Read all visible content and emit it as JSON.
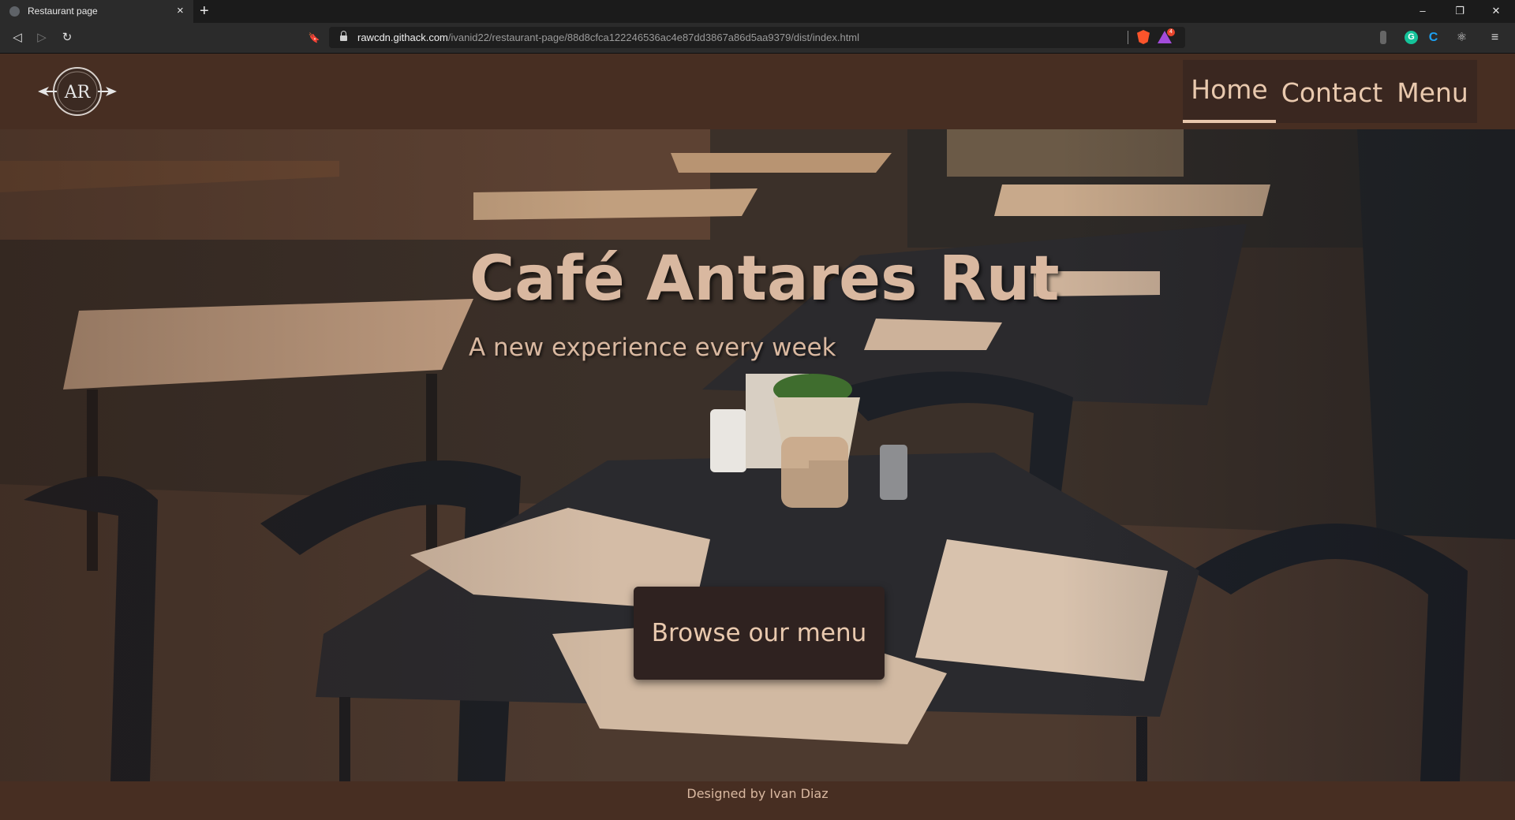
{
  "browser": {
    "tab": {
      "title": "Restaurant page",
      "close_glyph": "×",
      "favicon": "globe-icon"
    },
    "new_tab_glyph": "+",
    "window_controls": {
      "minimize": "–",
      "restore": "❐",
      "close": "✕"
    },
    "nav": {
      "back": "◁",
      "forward": "▷",
      "reload": "↻",
      "bookmark": "🔖"
    },
    "url": {
      "host": "rawcdn.githack.com",
      "path": "/ivanid22/restaurant-page/88d8cfca122246536ac4e87dd3867a86d5aa9379/dist/index.html"
    },
    "extensions": {
      "rewards_badge": "4",
      "grammarly": "G",
      "cc": "C",
      "react": "⚛",
      "menu": "≡"
    }
  },
  "site": {
    "logo_initials": "AR",
    "nav": [
      {
        "label": "Home",
        "active": true
      },
      {
        "label": "Contact",
        "active": false
      },
      {
        "label": "Menu",
        "active": false
      }
    ],
    "hero": {
      "title": "Café Antares Rut",
      "subtitle": "A new experience every week",
      "cta": "Browse our menu"
    },
    "footer": "Designed by Ivan Diaz"
  },
  "colors": {
    "header_bg": "#472e22",
    "nav_bg": "#3a2720",
    "accent_text": "#d9b8a0",
    "button_bg": "#2f2220"
  }
}
